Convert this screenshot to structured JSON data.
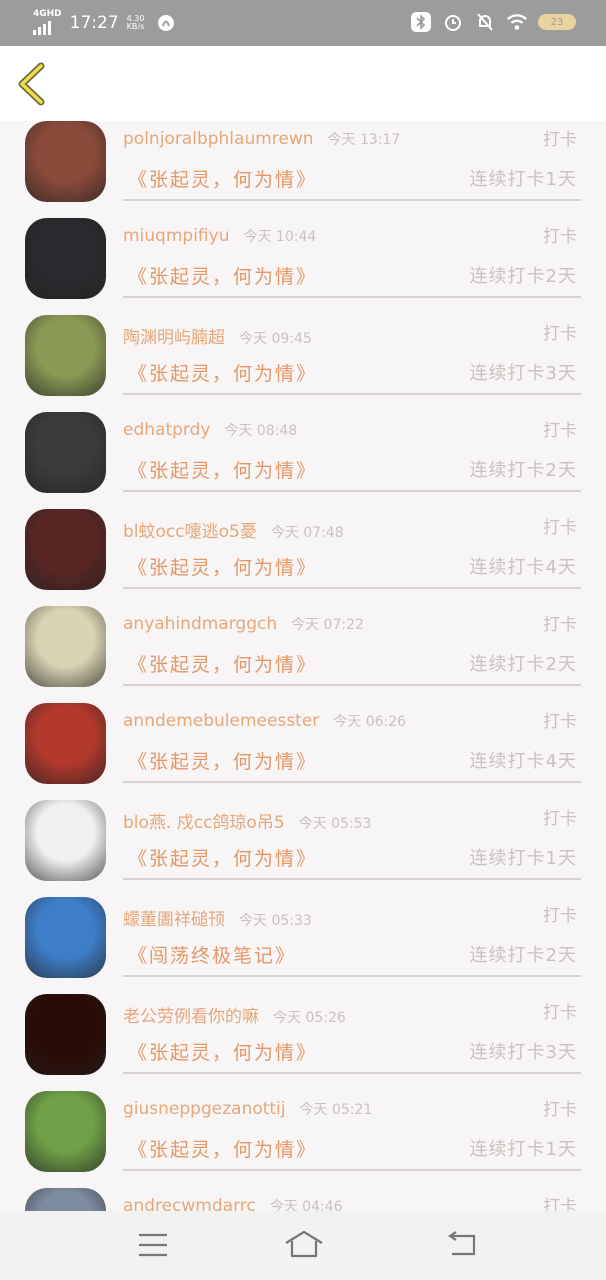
{
  "status": {
    "time": "17:27",
    "network": "4GHD",
    "speed": "4.30 KB/s",
    "battery": "23"
  },
  "rows": [
    {
      "name": "polnjoralbphlaumrewn",
      "time": "今天 13:17",
      "checkin": "打卡",
      "book": "《张起灵，何为情》",
      "streak": "连续打卡1天"
    },
    {
      "name": "miuqmpifiyu",
      "time": "今天 10:44",
      "checkin": "打卡",
      "book": "《张起灵，何为情》",
      "streak": "连续打卡2天"
    },
    {
      "name": "陶渊明屿腩超",
      "time": "今天 09:45",
      "checkin": "打卡",
      "book": "《张起灵，何为情》",
      "streak": "连续打卡3天"
    },
    {
      "name": "edhatprdy",
      "time": "今天 08:48",
      "checkin": "打卡",
      "book": "《张起灵，何为情》",
      "streak": "连续打卡2天"
    },
    {
      "name": "bl蚊occ嚏逃o5憂",
      "time": "今天 07:48",
      "checkin": "打卡",
      "book": "《张起灵，何为情》",
      "streak": "连续打卡4天"
    },
    {
      "name": "anyahindmarggch",
      "time": "今天 07:22",
      "checkin": "打卡",
      "book": "《张起灵，何为情》",
      "streak": "连续打卡2天"
    },
    {
      "name": "anndemebulemeesster",
      "time": "今天 06:26",
      "checkin": "打卡",
      "book": "《张起灵，何为情》",
      "streak": "连续打卡4天"
    },
    {
      "name": "blo燕. 戍cc鸽琼o吊5",
      "time": "今天 05:53",
      "checkin": "打卡",
      "book": "《张起灵，何为情》",
      "streak": "连续打卡1天"
    },
    {
      "name": "蠓董圕祥磓顸",
      "time": "今天 05:33",
      "checkin": "打卡",
      "book": "《闯荡终极笔记》",
      "streak": "连续打卡2天"
    },
    {
      "name": "老公劳例看你的嘛",
      "time": "今天 05:26",
      "checkin": "打卡",
      "book": "《张起灵，何为情》",
      "streak": "连续打卡3天"
    },
    {
      "name": "giusneppgezanottij",
      "time": "今天 05:21",
      "checkin": "打卡",
      "book": "《张起灵，何为情》",
      "streak": "连续打卡1天"
    },
    {
      "name": "andrecwmdarrc",
      "time": "今天 04:46",
      "checkin": "打卡",
      "book": "",
      "streak": ""
    }
  ],
  "avatar_icons": [
    "woman-portrait-avatar",
    "dark-warrior-avatar",
    "leaves-plate-avatar",
    "dark-text-avatar",
    "red-text-avatar",
    "green-cartoon-avatar",
    "red-leaf-avatar",
    "cartoon-boy-avatar",
    "red-hair-cartoon-avatar",
    "fire-horse-avatar",
    "dandelion-avatar",
    "portrait-avatar"
  ],
  "avatar_colors": [
    "#8a4a3a",
    "#2a2a2e",
    "#8a9a55",
    "#3b3b3b",
    "#5a2624",
    "#d9d2b3",
    "#b2382c",
    "#f1f0ee",
    "#3e7ec8",
    "#2a0a04",
    "#6f9f46",
    "#7d8ba0"
  ]
}
